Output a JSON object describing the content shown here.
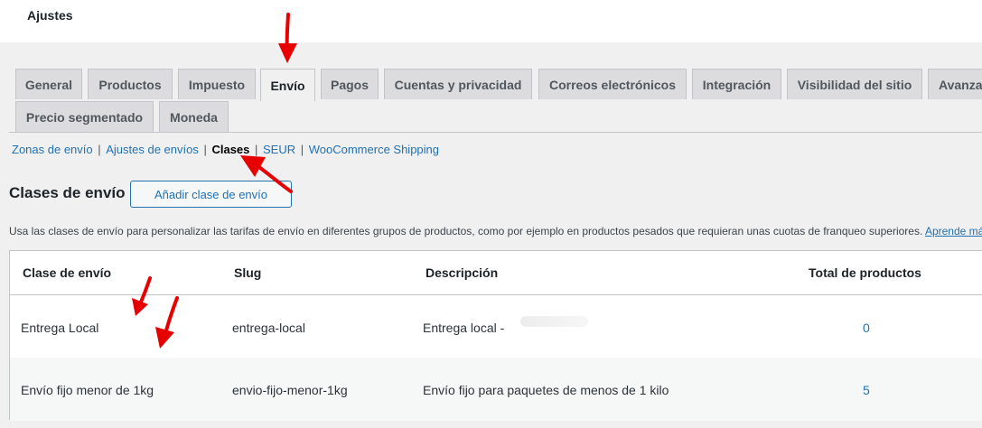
{
  "header": {
    "title": "Ajustes"
  },
  "tabs": [
    {
      "label": "General"
    },
    {
      "label": "Productos"
    },
    {
      "label": "Impuesto"
    },
    {
      "label": "Envío"
    },
    {
      "label": "Pagos"
    },
    {
      "label": "Cuentas y privacidad"
    },
    {
      "label": "Correos electrónicos"
    },
    {
      "label": "Integración"
    },
    {
      "label": "Visibilidad del sitio"
    },
    {
      "label": "Avanzado"
    },
    {
      "label": "Precio segmentado"
    },
    {
      "label": "Moneda"
    }
  ],
  "active_tab": "Envío",
  "sections": [
    {
      "label": "Zonas de envío"
    },
    {
      "label": "Ajustes de envíos"
    },
    {
      "label": "Clases"
    },
    {
      "label": "SEUR"
    },
    {
      "label": "WooCommerce Shipping"
    }
  ],
  "page": {
    "heading": "Clases de envío",
    "add_button": "Añadir clase de envío",
    "description": "Usa las clases de envío para personalizar las tarifas de envío en diferentes grupos de productos, como por ejemplo en productos pesados que requieran unas cuotas de franqueo superiores.",
    "description_link": "Aprende más"
  },
  "table": {
    "columns": [
      "Clase de envío",
      "Slug",
      "Descripción",
      "Total de productos"
    ],
    "rows": [
      {
        "name": "Entrega Local",
        "slug": "entrega-local",
        "description": "Entrega local -",
        "count": "0"
      },
      {
        "name": "Envío fijo menor de 1kg",
        "slug": "envio-fijo-menor-1kg",
        "description": "Envío fijo para paquetes de menos de 1 kilo",
        "count": "5"
      }
    ]
  },
  "colors": {
    "background": "#f0f0f1",
    "link": "#2271b1",
    "tab_inactive": "#dcdcde",
    "annotation_arrow": "#e60000"
  }
}
